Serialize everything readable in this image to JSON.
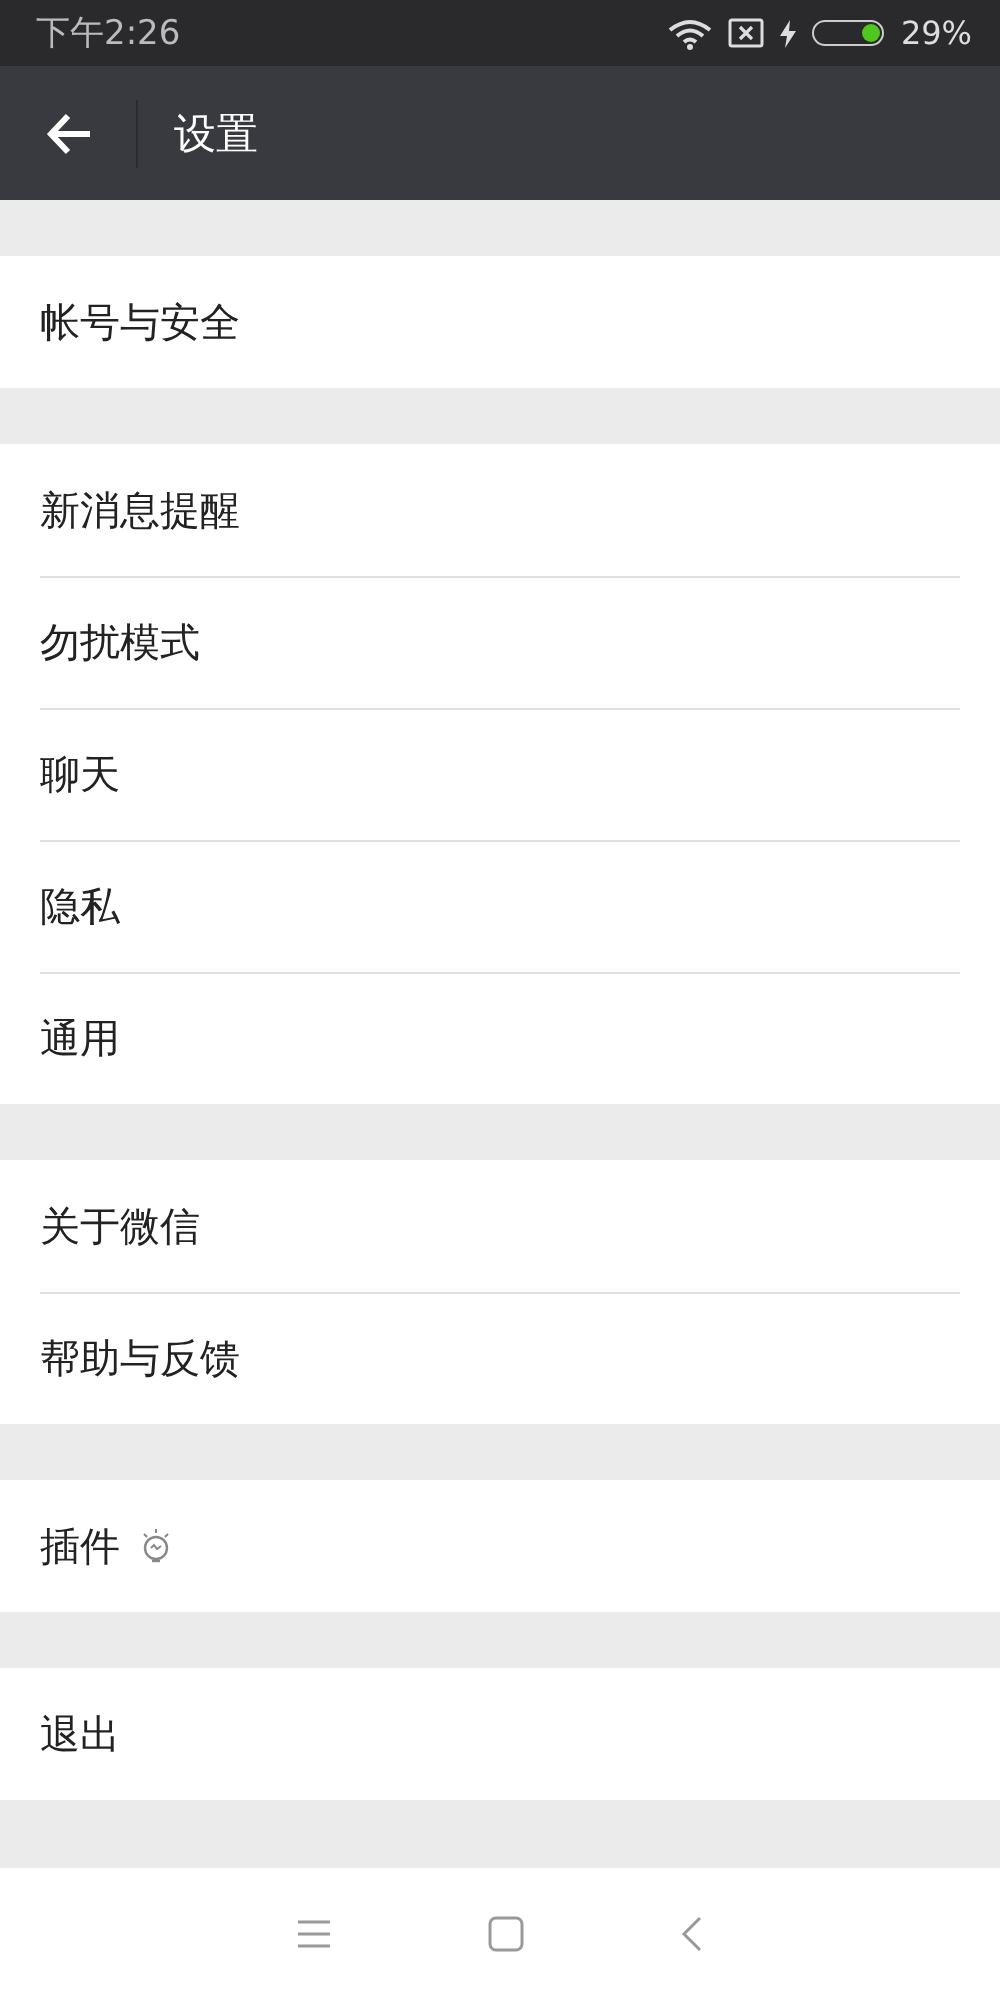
{
  "status_bar": {
    "time": "下午2:26",
    "battery": {
      "level": 0.29,
      "charging": true
    },
    "battery_text": "29%"
  },
  "header": {
    "title": "设置"
  },
  "groups": [
    {
      "items": [
        {
          "label": "帐号与安全",
          "kind": "plain"
        }
      ]
    },
    {
      "items": [
        {
          "label": "新消息提醒",
          "kind": "plain"
        },
        {
          "label": "勿扰模式",
          "kind": "plain"
        },
        {
          "label": "聊天",
          "kind": "plain"
        },
        {
          "label": "隐私",
          "kind": "plain"
        },
        {
          "label": "通用",
          "kind": "plain"
        }
      ]
    },
    {
      "items": [
        {
          "label": "关于微信",
          "kind": "plain"
        },
        {
          "label": "帮助与反馈",
          "kind": "plain"
        }
      ]
    },
    {
      "items": [
        {
          "label": "插件",
          "kind": "with-icon"
        }
      ]
    },
    {
      "items": [
        {
          "label": "退出",
          "kind": "plain"
        }
      ]
    }
  ]
}
